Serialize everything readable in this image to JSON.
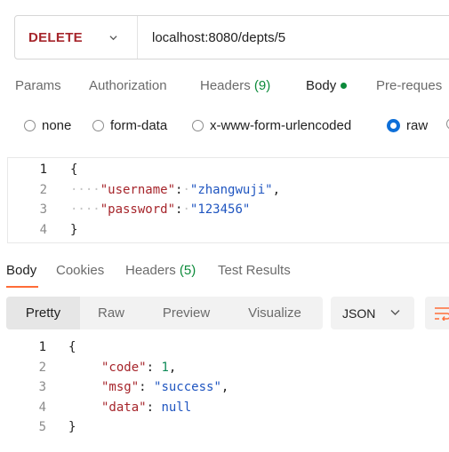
{
  "request": {
    "method": "DELETE",
    "url": "localhost:8080/depts/5"
  },
  "request_tabs": {
    "params": "Params",
    "authorization": "Authorization",
    "headers": "Headers",
    "headers_count": "(9)",
    "body": "Body",
    "prerequest": "Pre-reques"
  },
  "body_types": {
    "none": "none",
    "form_data": "form-data",
    "urlencoded": "x-www-form-urlencoded",
    "raw": "raw",
    "selected": "raw"
  },
  "request_body": {
    "lines": [
      "1",
      "2",
      "3",
      "4"
    ],
    "open": "{",
    "k_username": "\"username\"",
    "v_username": "\"zhangwuji\"",
    "k_password": "\"password\"",
    "v_password": "\"123456\"",
    "close": "}"
  },
  "response_tabs": {
    "body": "Body",
    "cookies": "Cookies",
    "headers": "Headers",
    "headers_count": "(5)",
    "test_results": "Test Results"
  },
  "view_modes": {
    "pretty": "Pretty",
    "raw": "Raw",
    "preview": "Preview",
    "visualize": "Visualize",
    "format": "JSON"
  },
  "response_body": {
    "lines": [
      "1",
      "2",
      "3",
      "4",
      "5"
    ],
    "open": "{",
    "k_code": "\"code\"",
    "v_code": "1",
    "k_msg": "\"msg\"",
    "v_msg": "\"success\"",
    "k_data": "\"data\"",
    "v_data": "null",
    "close": "}"
  },
  "colors": {
    "method": "#a6252b",
    "accent_tab": "#ff6c37",
    "radio_checked": "#0e6fd8",
    "count_green": "#0c8a3a"
  }
}
